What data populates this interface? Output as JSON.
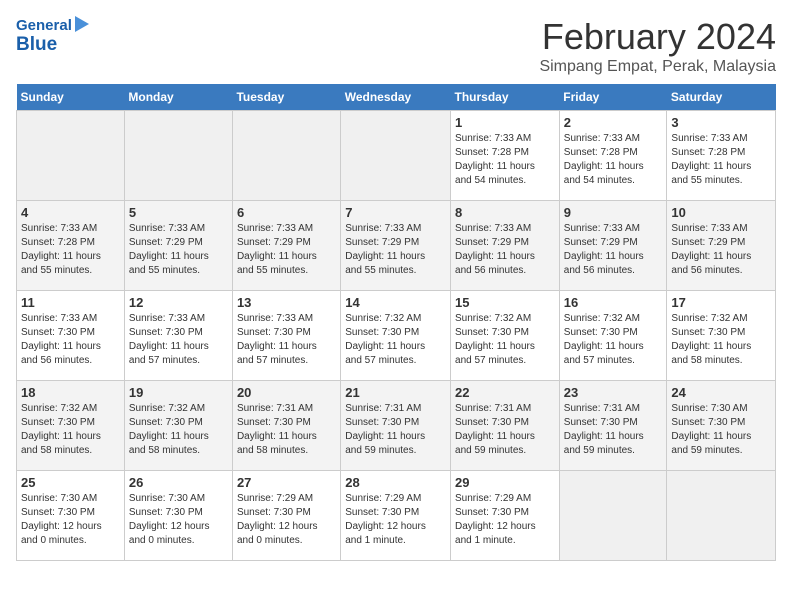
{
  "logo": {
    "line1": "General",
    "line2": "Blue"
  },
  "title": "February 2024",
  "subtitle": "Simpang Empat, Perak, Malaysia",
  "weekdays": [
    "Sunday",
    "Monday",
    "Tuesday",
    "Wednesday",
    "Thursday",
    "Friday",
    "Saturday"
  ],
  "weeks": [
    [
      {
        "num": "",
        "detail": ""
      },
      {
        "num": "",
        "detail": ""
      },
      {
        "num": "",
        "detail": ""
      },
      {
        "num": "",
        "detail": ""
      },
      {
        "num": "1",
        "detail": "Sunrise: 7:33 AM\nSunset: 7:28 PM\nDaylight: 11 hours\nand 54 minutes."
      },
      {
        "num": "2",
        "detail": "Sunrise: 7:33 AM\nSunset: 7:28 PM\nDaylight: 11 hours\nand 54 minutes."
      },
      {
        "num": "3",
        "detail": "Sunrise: 7:33 AM\nSunset: 7:28 PM\nDaylight: 11 hours\nand 55 minutes."
      }
    ],
    [
      {
        "num": "4",
        "detail": "Sunrise: 7:33 AM\nSunset: 7:28 PM\nDaylight: 11 hours\nand 55 minutes."
      },
      {
        "num": "5",
        "detail": "Sunrise: 7:33 AM\nSunset: 7:29 PM\nDaylight: 11 hours\nand 55 minutes."
      },
      {
        "num": "6",
        "detail": "Sunrise: 7:33 AM\nSunset: 7:29 PM\nDaylight: 11 hours\nand 55 minutes."
      },
      {
        "num": "7",
        "detail": "Sunrise: 7:33 AM\nSunset: 7:29 PM\nDaylight: 11 hours\nand 55 minutes."
      },
      {
        "num": "8",
        "detail": "Sunrise: 7:33 AM\nSunset: 7:29 PM\nDaylight: 11 hours\nand 56 minutes."
      },
      {
        "num": "9",
        "detail": "Sunrise: 7:33 AM\nSunset: 7:29 PM\nDaylight: 11 hours\nand 56 minutes."
      },
      {
        "num": "10",
        "detail": "Sunrise: 7:33 AM\nSunset: 7:29 PM\nDaylight: 11 hours\nand 56 minutes."
      }
    ],
    [
      {
        "num": "11",
        "detail": "Sunrise: 7:33 AM\nSunset: 7:30 PM\nDaylight: 11 hours\nand 56 minutes."
      },
      {
        "num": "12",
        "detail": "Sunrise: 7:33 AM\nSunset: 7:30 PM\nDaylight: 11 hours\nand 57 minutes."
      },
      {
        "num": "13",
        "detail": "Sunrise: 7:33 AM\nSunset: 7:30 PM\nDaylight: 11 hours\nand 57 minutes."
      },
      {
        "num": "14",
        "detail": "Sunrise: 7:32 AM\nSunset: 7:30 PM\nDaylight: 11 hours\nand 57 minutes."
      },
      {
        "num": "15",
        "detail": "Sunrise: 7:32 AM\nSunset: 7:30 PM\nDaylight: 11 hours\nand 57 minutes."
      },
      {
        "num": "16",
        "detail": "Sunrise: 7:32 AM\nSunset: 7:30 PM\nDaylight: 11 hours\nand 57 minutes."
      },
      {
        "num": "17",
        "detail": "Sunrise: 7:32 AM\nSunset: 7:30 PM\nDaylight: 11 hours\nand 58 minutes."
      }
    ],
    [
      {
        "num": "18",
        "detail": "Sunrise: 7:32 AM\nSunset: 7:30 PM\nDaylight: 11 hours\nand 58 minutes."
      },
      {
        "num": "19",
        "detail": "Sunrise: 7:32 AM\nSunset: 7:30 PM\nDaylight: 11 hours\nand 58 minutes."
      },
      {
        "num": "20",
        "detail": "Sunrise: 7:31 AM\nSunset: 7:30 PM\nDaylight: 11 hours\nand 58 minutes."
      },
      {
        "num": "21",
        "detail": "Sunrise: 7:31 AM\nSunset: 7:30 PM\nDaylight: 11 hours\nand 59 minutes."
      },
      {
        "num": "22",
        "detail": "Sunrise: 7:31 AM\nSunset: 7:30 PM\nDaylight: 11 hours\nand 59 minutes."
      },
      {
        "num": "23",
        "detail": "Sunrise: 7:31 AM\nSunset: 7:30 PM\nDaylight: 11 hours\nand 59 minutes."
      },
      {
        "num": "24",
        "detail": "Sunrise: 7:30 AM\nSunset: 7:30 PM\nDaylight: 11 hours\nand 59 minutes."
      }
    ],
    [
      {
        "num": "25",
        "detail": "Sunrise: 7:30 AM\nSunset: 7:30 PM\nDaylight: 12 hours\nand 0 minutes."
      },
      {
        "num": "26",
        "detail": "Sunrise: 7:30 AM\nSunset: 7:30 PM\nDaylight: 12 hours\nand 0 minutes."
      },
      {
        "num": "27",
        "detail": "Sunrise: 7:29 AM\nSunset: 7:30 PM\nDaylight: 12 hours\nand 0 minutes."
      },
      {
        "num": "28",
        "detail": "Sunrise: 7:29 AM\nSunset: 7:30 PM\nDaylight: 12 hours\nand 1 minute."
      },
      {
        "num": "29",
        "detail": "Sunrise: 7:29 AM\nSunset: 7:30 PM\nDaylight: 12 hours\nand 1 minute."
      },
      {
        "num": "",
        "detail": ""
      },
      {
        "num": "",
        "detail": ""
      }
    ]
  ]
}
